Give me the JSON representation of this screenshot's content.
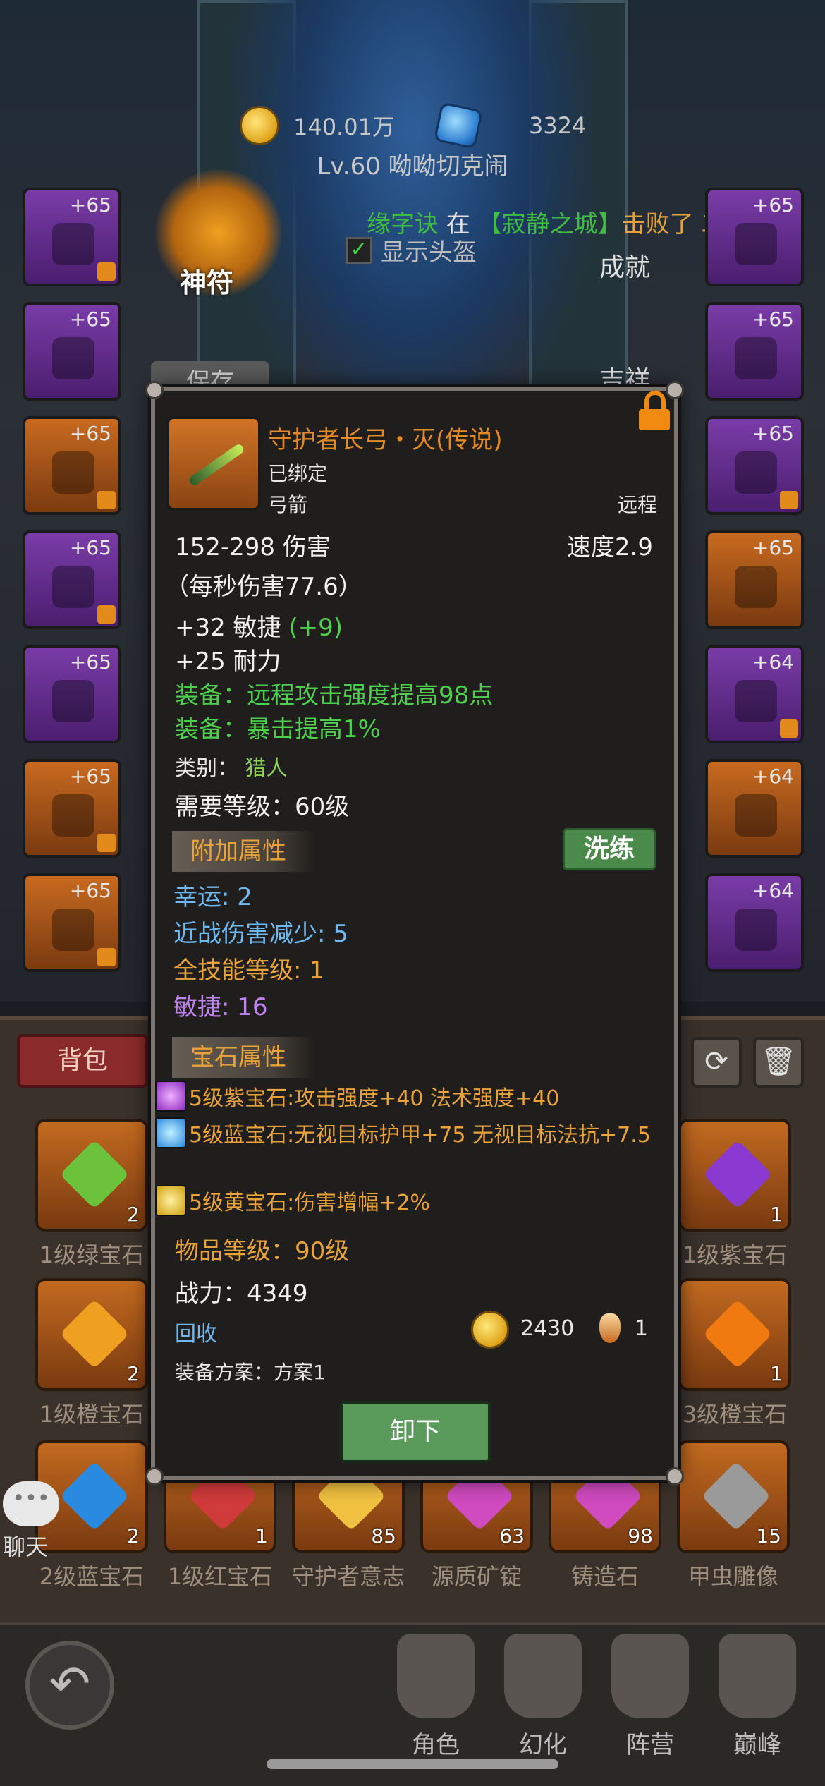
{
  "hud": {
    "gold": "140.01万",
    "gems": "3324",
    "level_name": "Lv.60 呦呦切克闹"
  },
  "notice": {
    "player": "缘字诀",
    "mid": " 在 ",
    "place": "【寂静之城】",
    "tail": "击败了 二妹"
  },
  "show_helmet_label": "显示头盔",
  "rune_label": "神符",
  "achievement_label": "成就",
  "zhanhun_label": "吉祥",
  "save_label": "保存",
  "left_slots": [
    {
      "plus": "+65",
      "rarity": "purple",
      "locked": true
    },
    {
      "plus": "+65",
      "rarity": "purple",
      "locked": false
    },
    {
      "plus": "+65",
      "rarity": "orange",
      "locked": true
    },
    {
      "plus": "+65",
      "rarity": "purple",
      "locked": true
    },
    {
      "plus": "+65",
      "rarity": "purple",
      "locked": false
    },
    {
      "plus": "+65",
      "rarity": "orange",
      "locked": true
    },
    {
      "plus": "+65",
      "rarity": "orange",
      "locked": true
    }
  ],
  "right_slots": [
    {
      "plus": "+65",
      "rarity": "purple",
      "locked": false
    },
    {
      "plus": "+65",
      "rarity": "purple",
      "locked": false
    },
    {
      "plus": "+65",
      "rarity": "purple",
      "locked": true
    },
    {
      "plus": "+65",
      "rarity": "orange",
      "locked": false
    },
    {
      "plus": "+64",
      "rarity": "purple",
      "locked": true
    },
    {
      "plus": "+64",
      "rarity": "orange",
      "locked": false
    },
    {
      "plus": "+64",
      "rarity": "purple",
      "locked": false
    }
  ],
  "tooltip": {
    "name": "守护者长弓・灭(传说)",
    "bound": "已绑定",
    "type": "弓箭",
    "range": "远程",
    "damage": "152-298 伤害",
    "speed": "速度2.9",
    "dps": "（每秒伤害77.6）",
    "agility": "+32 敏捷",
    "agility_bonus": "(+9)",
    "stamina": "+25 耐力",
    "equip1": "装备：远程攻击强度提高98点",
    "equip2": "装备：暴击提高1%",
    "class_label": "类别：",
    "class_value": "猎人",
    "req_level": "需要等级：60级",
    "extra_header": "附加属性",
    "refine_label": "洗练",
    "extra": [
      {
        "text": "幸运: 2",
        "color": "blue"
      },
      {
        "text": "近战伤害减少: 5",
        "color": "blue"
      },
      {
        "text": "全技能等级: 1",
        "color": "orange"
      },
      {
        "text": "敏捷: 16",
        "color": "purple"
      }
    ],
    "gem_header": "宝石属性",
    "gems": [
      {
        "type": "p",
        "text": "5级紫宝石:攻击强度+40 法术强度+40"
      },
      {
        "type": "b",
        "text": "5级蓝宝石:无视目标护甲+75 无视目标法抗+7.5"
      },
      {
        "type": "y",
        "text": "5级黄宝石:伤害增幅+2%"
      }
    ],
    "item_level": "物品等级：90级",
    "power": "战力：4349",
    "recycle_label": "回收",
    "sell_gold": "2430",
    "sell_shard": "1",
    "scheme": "装备方案：方案1",
    "unequip_label": "卸下"
  },
  "bag": {
    "tab_label": "背包",
    "rows": [
      [
        {
          "label": "1级绿宝石",
          "count": "2",
          "color": "#6cc23a"
        },
        {
          "label": "1级紫宝石",
          "count": "1",
          "color": "#8a3ad0"
        }
      ],
      [
        {
          "label": "1级橙宝石",
          "count": "2",
          "color": "#f0a020"
        },
        {
          "label": "3级橙宝石",
          "count": "1",
          "color": "#f07a10"
        }
      ]
    ],
    "bottom_row": [
      {
        "label": "2级蓝宝石",
        "count": "2",
        "color": "#2a8ae0"
      },
      {
        "label": "1级红宝石",
        "count": "1",
        "color": "#d03a3a"
      },
      {
        "label": "守护者意志",
        "count": "85",
        "color": "#f0c040"
      },
      {
        "label": "源质矿锭",
        "count": "63",
        "color": "#d04ac0"
      },
      {
        "label": "铸造石",
        "count": "98",
        "color": "#d04ac0"
      },
      {
        "label": "甲虫雕像",
        "count": "15",
        "color": "#9a9a9a"
      }
    ]
  },
  "chat_label": "聊天",
  "nav": [
    {
      "label": "角色"
    },
    {
      "label": "幻化"
    },
    {
      "label": "阵营"
    },
    {
      "label": "巅峰"
    }
  ]
}
